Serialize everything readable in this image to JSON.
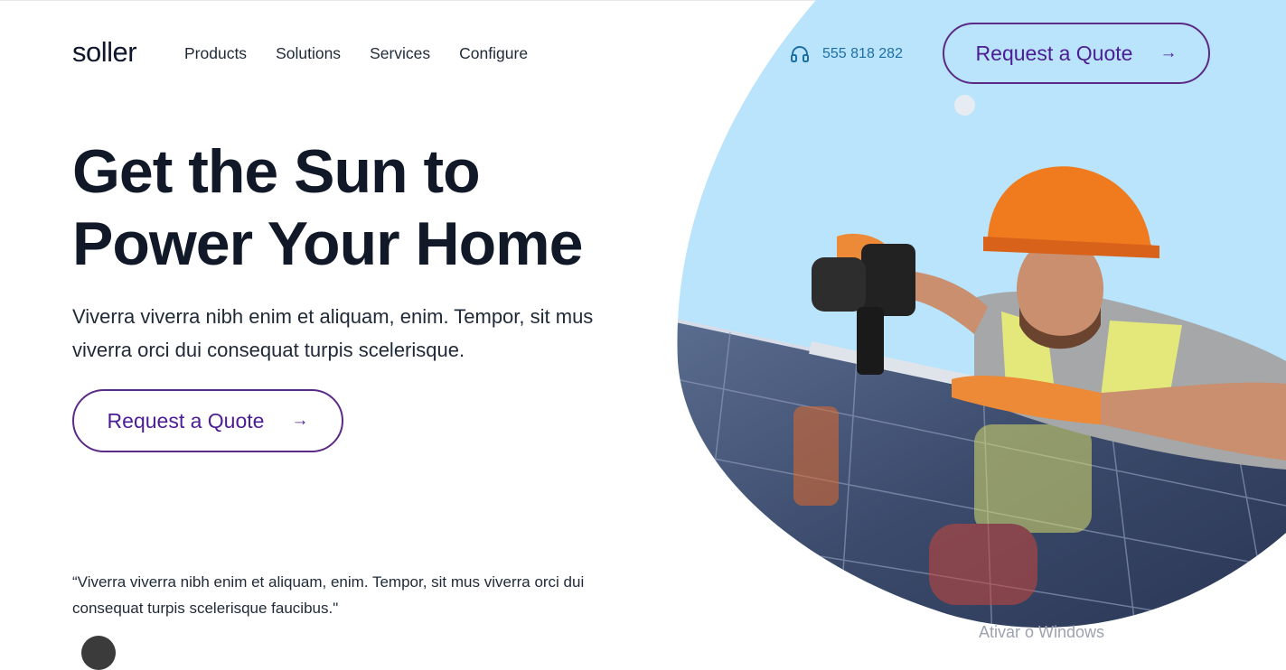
{
  "brand": {
    "logo_text": "soller"
  },
  "nav": {
    "items": [
      {
        "label": "Products"
      },
      {
        "label": "Solutions"
      },
      {
        "label": "Services"
      },
      {
        "label": "Configure"
      }
    ]
  },
  "contact": {
    "phone": "555 818 282",
    "icon": "headphones-icon"
  },
  "header_cta": {
    "label": "Request a Quote",
    "icon": "arrow-right-icon"
  },
  "hero": {
    "title_line1": "Get the Sun to",
    "title_line2": "Power Your Home",
    "subtitle": "Viverra viverra nibh enim et aliquam, enim. Tempor, sit mus viverra orci dui consequat turpis scelerisque.",
    "cta_label": "Request a Quote",
    "image_alt": "worker installing solar panel"
  },
  "testimonial": {
    "quote": "“Viverra viverra nibh enim et aliquam, enim. Tempor, sit mus viverra orci dui consequat turpis scelerisque faucibus.\""
  },
  "os_watermark": "Ativar o Windows",
  "colors": {
    "accent": "#4c1d95",
    "phone": "#1d6fa5",
    "sky": "#b9e4fb",
    "heading": "#111827"
  }
}
